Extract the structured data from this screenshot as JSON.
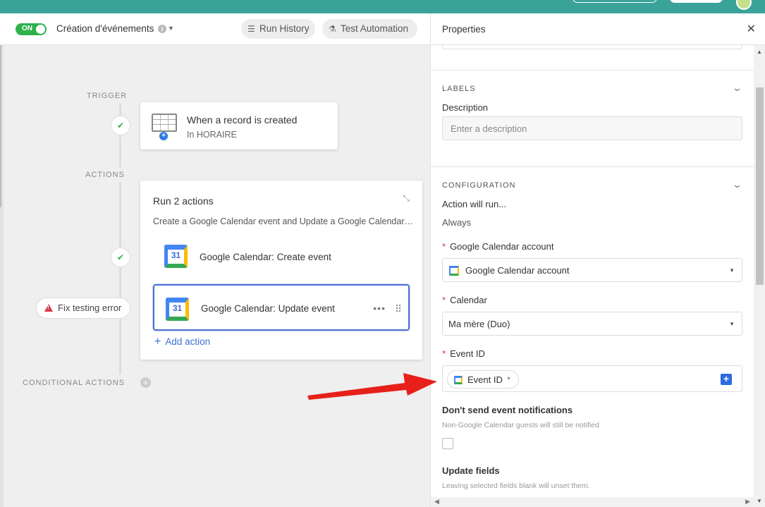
{
  "toolbar": {
    "toggle_label": "ON",
    "workflow_title": "Création d'événements",
    "run_history": "Run History",
    "test_automation": "Test Automation"
  },
  "canvas": {
    "trigger_label": "TRIGGER",
    "actions_label": "ACTIONS",
    "conditional_label": "CONDITIONAL ACTIONS",
    "trigger": {
      "title": "When a record is created",
      "subtitle": "In HORAIRE"
    },
    "actions_group": {
      "title": "Run 2 actions",
      "description": "Create a Google Calendar event and Update a Google Calendar event",
      "steps": [
        {
          "icon_text": "31",
          "label": "Google Calendar: Create event"
        },
        {
          "icon_text": "31",
          "label": "Google Calendar: Update event"
        }
      ],
      "add_action": "Add action"
    },
    "fix_error": "Fix testing error"
  },
  "properties": {
    "title": "Properties",
    "labels_section": "LABELS",
    "description_label": "Description",
    "description_placeholder": "Enter a description",
    "configuration_section": "CONFIGURATION",
    "action_will_run_label": "Action will run...",
    "action_will_run_value": "Always",
    "account_label": "Google Calendar account",
    "account_value": "Google Calendar account",
    "calendar_label": "Calendar",
    "calendar_value": "Ma mère (Duo)",
    "event_id_label": "Event ID",
    "event_id_token": "Event ID",
    "notifications_label": "Don't send event notifications",
    "notifications_hint": "Non-Google Calendar guests will still be notified",
    "update_fields_label": "Update fields",
    "update_fields_hint": "Leaving selected fields blank will unset them."
  },
  "colors": {
    "accent_green": "#2db24a",
    "link_blue": "#3b6fd8",
    "error_red": "#d8354a",
    "annotation_arrow": "#e8201a"
  }
}
